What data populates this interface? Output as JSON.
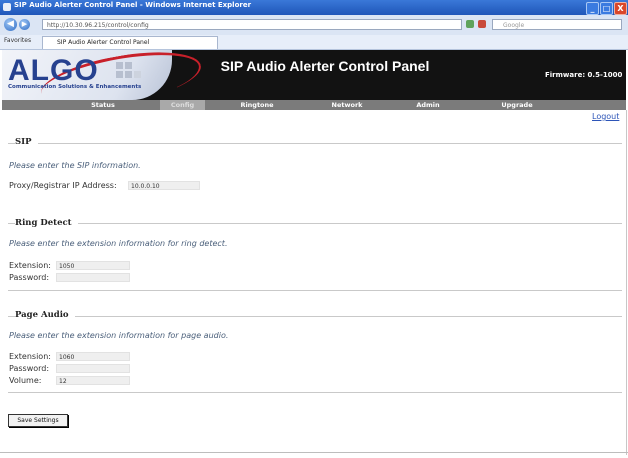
{
  "window": {
    "title": "SIP Audio Alerter Control Panel - Windows Internet Explorer",
    "minimize_glyph": "_",
    "maximize_glyph": "□",
    "close_glyph": "X"
  },
  "browser": {
    "back_glyph": "◀",
    "forward_glyph": "▶",
    "url": "http://10.30.96.215/control/config",
    "search_placeholder": "Google",
    "favorites_label": "Favorites",
    "tab_title": "SIP Audio Alerter Control Panel"
  },
  "header": {
    "logo_text": "ALGO",
    "logo_tagline": "Communication Solutions & Enhancements",
    "title": "SIP Audio Alerter Control Panel",
    "firmware": "Firmware: 0.5-1000"
  },
  "nav": {
    "items": [
      {
        "label": "Status",
        "active": false
      },
      {
        "label": "Config",
        "active": true
      },
      {
        "label": "Ringtone",
        "active": false
      },
      {
        "label": "Network",
        "active": false
      },
      {
        "label": "Admin",
        "active": false
      },
      {
        "label": "Upgrade",
        "active": false
      }
    ],
    "logout": "Logout"
  },
  "sip": {
    "title": "SIP",
    "prompt": "Please enter the SIP information.",
    "proxy_label": "Proxy/Registrar IP Address:",
    "proxy_value": "10.0.0.10"
  },
  "ring_detect": {
    "title": "Ring Detect",
    "prompt": "Please enter the extension information for ring detect.",
    "extension_label": "Extension:",
    "extension_value": "1050",
    "password_label": "Password:",
    "password_value": ""
  },
  "page_audio": {
    "title": "Page Audio",
    "prompt": "Please enter the extension information for page audio.",
    "extension_label": "Extension:",
    "extension_value": "1060",
    "password_label": "Password:",
    "password_value": "",
    "volume_label": "Volume:",
    "volume_value": "12"
  },
  "actions": {
    "save_label": "Save Settings"
  },
  "colors": {
    "titlebar": "#1f56b9",
    "banner": "#121212",
    "nav": "#7b7b7b",
    "brand_blue": "#26418f",
    "brand_red": "#c8202a",
    "link": "#2d55b8"
  }
}
